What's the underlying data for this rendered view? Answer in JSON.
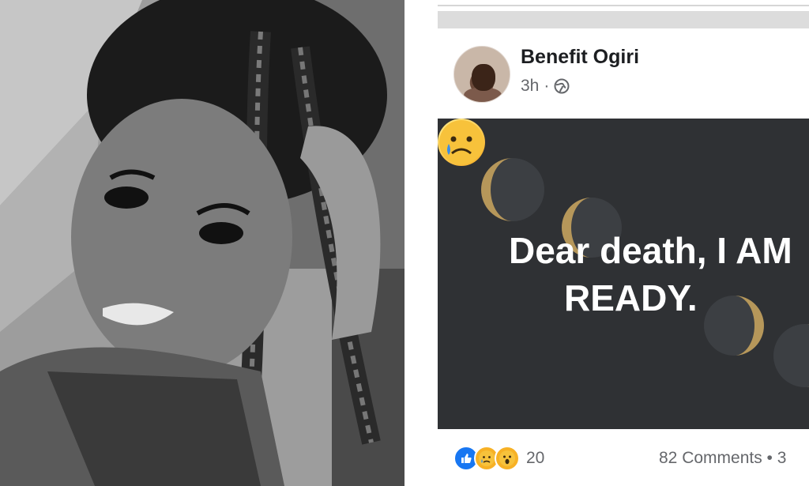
{
  "photo": {
    "description_icon": "portrait-photo"
  },
  "post": {
    "author": "Benefit Ogiri",
    "time": "3h",
    "separator": "·",
    "privacy_icon": "globe-icon",
    "card": {
      "line1": "Dear death, I AM",
      "line2": "READY.",
      "emoji": "crying-face-emoji",
      "background_color": "#2f3134",
      "accent_color": "#b6975a"
    },
    "reactions": {
      "icons": [
        "like-icon",
        "sad-icon",
        "wow-icon"
      ],
      "count": "20"
    },
    "comments_text": "82 Comments • 3"
  }
}
